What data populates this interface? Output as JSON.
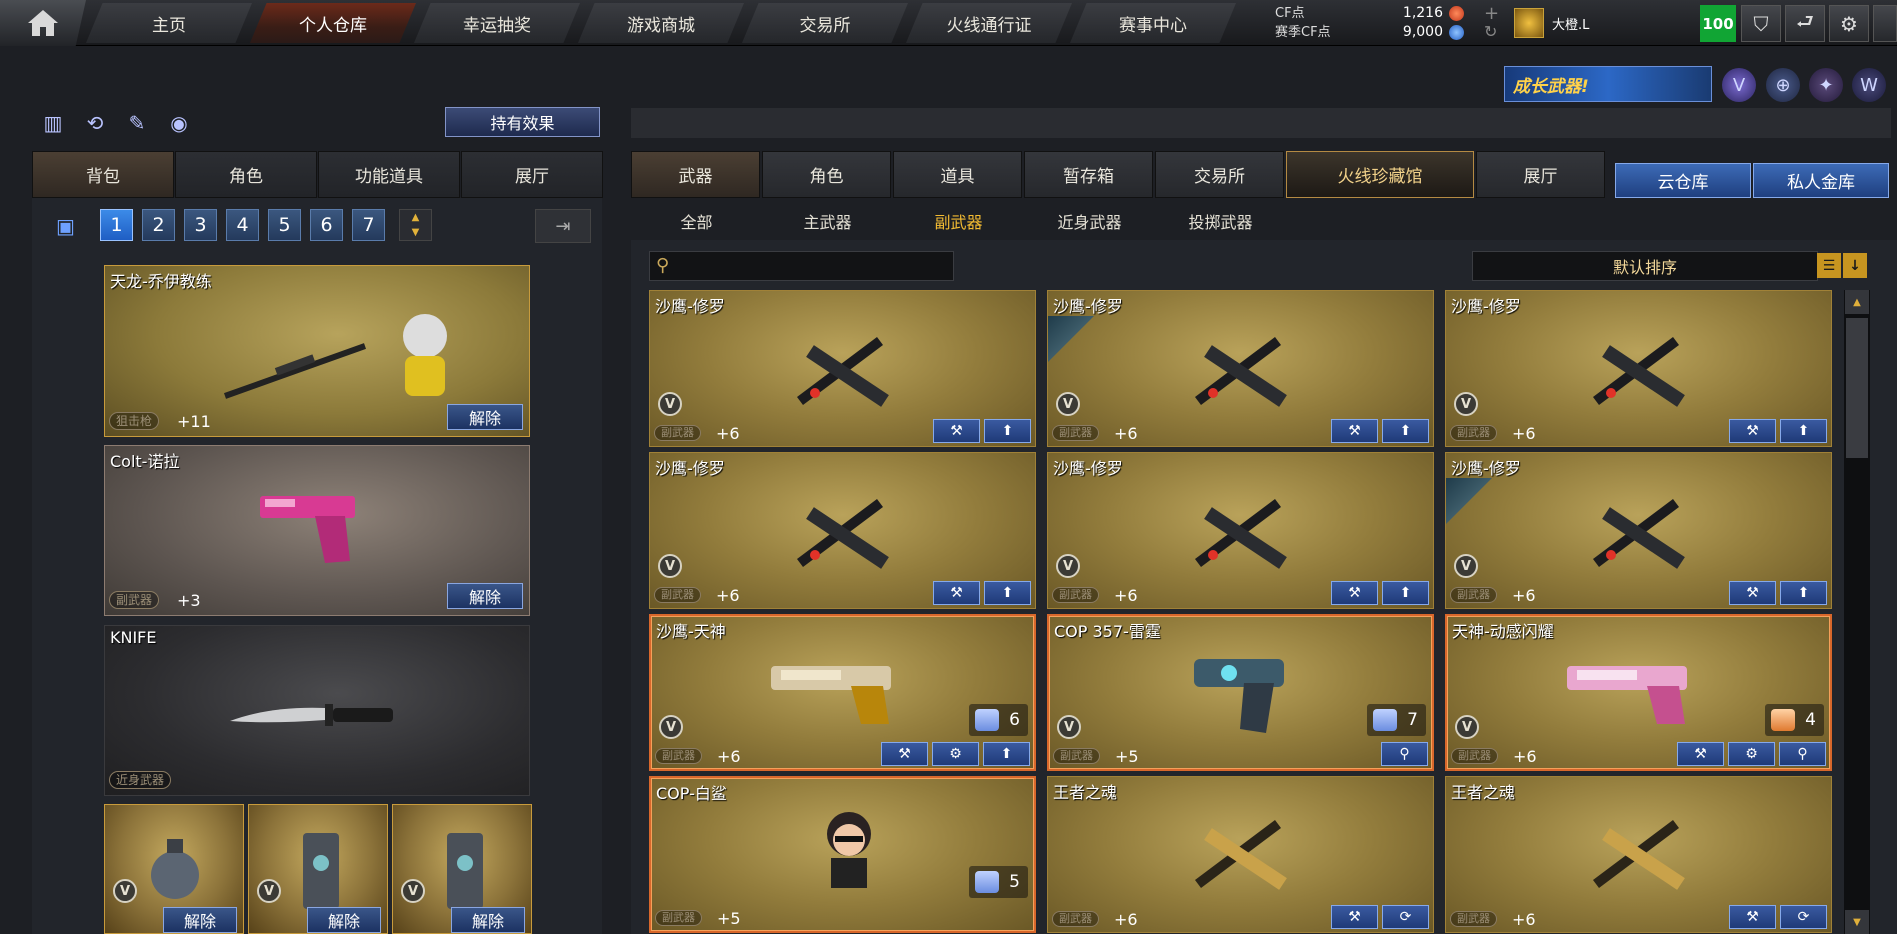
{
  "nav": {
    "home_icon": "home-icon",
    "items": [
      {
        "label": "主页"
      },
      {
        "label": "个人仓库"
      },
      {
        "label": "幸运抽奖"
      },
      {
        "label": "游戏商城"
      },
      {
        "label": "交易所"
      },
      {
        "label": "火线通行证"
      },
      {
        "label": "赛事中心"
      }
    ],
    "active_index": 1
  },
  "currency": {
    "cf_label": "CF点",
    "cf_value": "1,216",
    "season_label": "赛季CF点",
    "season_value": "9,000"
  },
  "user": {
    "name": "大橙.L",
    "level": "100"
  },
  "header": {
    "promo_text": "成长武器!"
  },
  "left": {
    "effect_button": "持有效果",
    "tabs": [
      {
        "label": "背包"
      },
      {
        "label": "角色"
      },
      {
        "label": "功能道具"
      },
      {
        "label": "展厅"
      }
    ],
    "pages": [
      "1",
      "2",
      "3",
      "4",
      "5",
      "6",
      "7"
    ],
    "active_page": "1",
    "equipped": [
      {
        "name": "天龙-乔伊教练",
        "tag": "狙击枪",
        "level": "+11",
        "release": "解除"
      },
      {
        "name": "Colt-诺拉",
        "tag": "副武器",
        "level": "+3",
        "release": "解除"
      },
      {
        "name": "KNIFE",
        "tag": "近身武器"
      }
    ],
    "throwables": [
      {
        "release": "解除"
      },
      {
        "release": "解除"
      },
      {
        "release": "解除"
      }
    ]
  },
  "right": {
    "tabs": [
      {
        "label": "武器"
      },
      {
        "label": "角色"
      },
      {
        "label": "道具"
      },
      {
        "label": "暂存箱"
      },
      {
        "label": "交易所"
      },
      {
        "label": "火线珍藏馆"
      },
      {
        "label": "展厅"
      }
    ],
    "cloud_button": "云仓库",
    "vault_button": "私人金库",
    "subtabs": [
      {
        "label": "全部"
      },
      {
        "label": "主武器"
      },
      {
        "label": "副武器"
      },
      {
        "label": "近身武器"
      },
      {
        "label": "投掷武器"
      }
    ],
    "active_subtab": "副武器",
    "search": {
      "placeholder": "",
      "value": ""
    },
    "sort_label": "默认排序",
    "items": [
      {
        "name": "沙鹰-修罗",
        "tag": "副武器",
        "level": "+6"
      },
      {
        "name": "沙鹰-修罗",
        "tag": "副武器",
        "level": "+6"
      },
      {
        "name": "沙鹰-修罗",
        "tag": "副武器",
        "level": "+6"
      },
      {
        "name": "沙鹰-修罗",
        "tag": "副武器",
        "level": "+6"
      },
      {
        "name": "沙鹰-修罗",
        "tag": "副武器",
        "level": "+6"
      },
      {
        "name": "沙鹰-修罗",
        "tag": "副武器",
        "level": "+6"
      },
      {
        "name": "沙鹰-天神",
        "tag": "副武器",
        "level": "+6",
        "count": "6"
      },
      {
        "name": "COP 357-雷霆",
        "tag": "副武器",
        "level": "+5",
        "count": "7"
      },
      {
        "name": "天神-动感闪耀",
        "tag": "副武器",
        "level": "+6",
        "count": "4"
      },
      {
        "name": "COP-白鲨",
        "tag": "副武器",
        "level": "+5",
        "count": "5"
      },
      {
        "name": "王者之魂",
        "tag": "副武器",
        "level": "+6"
      },
      {
        "name": "王者之魂",
        "tag": "副武器",
        "level": "+6"
      }
    ]
  },
  "colors": {
    "accent_gold": "#f3bb32",
    "level_green": "#11a534",
    "button_blue": "#3a5689",
    "rare_border": "#d8672b"
  }
}
